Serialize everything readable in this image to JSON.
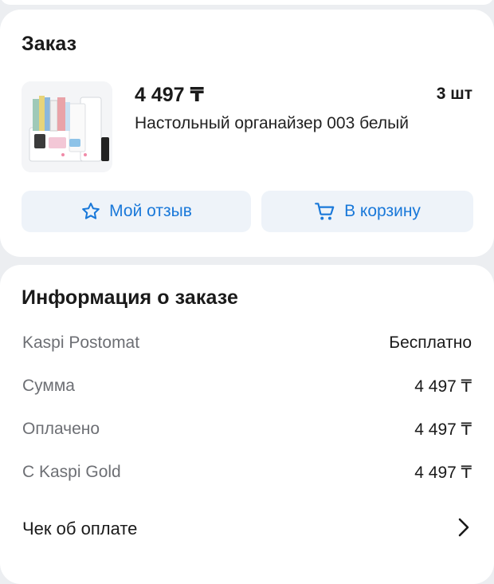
{
  "order": {
    "title": "Заказ",
    "product": {
      "price": "4 497 ₸",
      "quantity": "3 шт",
      "name": "Настольный органайзер 003 белый",
      "image": "desk-organizer-photo"
    },
    "buttons": {
      "review_label": "Мой отзыв",
      "review_icon": "star-icon",
      "cart_label": "В корзину",
      "cart_icon": "cart-icon"
    }
  },
  "info": {
    "title": "Информация о заказе",
    "rows": [
      {
        "label": "Kaspi Postomat",
        "value": "Бесплатно"
      },
      {
        "label": "Сумма",
        "value": "4 497 ₸"
      },
      {
        "label": "Оплачено",
        "value": "4 497 ₸"
      },
      {
        "label": "С Kaspi Gold",
        "value": "4 497 ₸"
      }
    ],
    "receipt": {
      "label": "Чек об оплате",
      "icon": "chevron-right-icon"
    }
  },
  "colors": {
    "accent": "#1978d9",
    "button_bg": "#eef3f9",
    "page_bg": "#eceef1",
    "label_gray": "#6d6f74"
  }
}
